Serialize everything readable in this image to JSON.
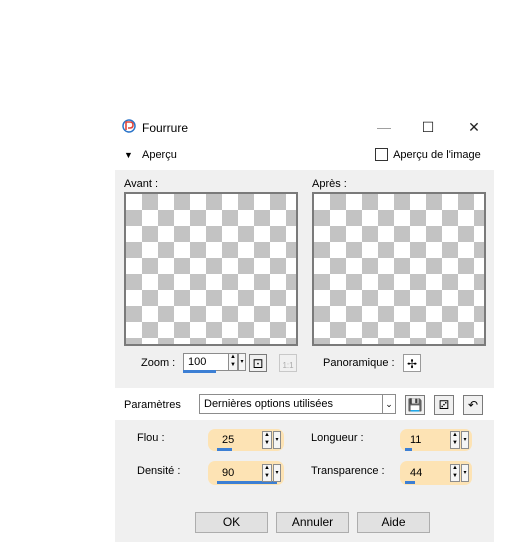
{
  "window": {
    "title": "Fourrure",
    "minimize_glyph": "—",
    "maximize_glyph": "☐",
    "close_glyph": "✕"
  },
  "preview": {
    "toggle_glyph": "▼",
    "toggle_label": "Aperçu",
    "image_preview_label": "Aperçu de l'image",
    "before_label": "Avant :",
    "after_label": "Après :",
    "zoom_label": "Zoom :",
    "zoom_value": "100",
    "pan_label": "Panoramique :"
  },
  "parameters": {
    "label": "Paramètres",
    "preset_value": "Dernières options utilisées"
  },
  "fields": {
    "flou_label": "Flou :",
    "flou_value": "25",
    "densite_label": "Densité :",
    "densite_value": "90",
    "longueur_label": "Longueur :",
    "longueur_value": "11",
    "transparence_label": "Transparence :",
    "transparence_value": "44"
  },
  "buttons": {
    "ok": "OK",
    "cancel": "Annuler",
    "help": "Aide"
  },
  "colors": {
    "accent_underline": "#3c7fd4",
    "highlight": "#fde3b4",
    "panel": "#f0f0f0"
  }
}
